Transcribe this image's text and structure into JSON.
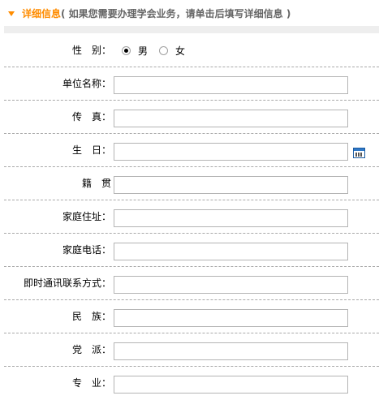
{
  "header": {
    "title": "详细信息",
    "subtitle": "( 如果您需要办理学会业务，请单击后填写详细信息 )"
  },
  "colors": {
    "accent": "#ff8c00",
    "subtitle": "#666666",
    "strip": "#eeeeee",
    "divider": "#a9a9a9"
  },
  "form": {
    "gender": {
      "label": "性　别：",
      "options": [
        "男",
        "女"
      ],
      "selected": "男"
    },
    "fields": [
      {
        "label": "单位名称：",
        "value": ""
      },
      {
        "label": "传　真：",
        "value": ""
      },
      {
        "label": "生　日：",
        "value": "",
        "icon": "calendar-icon"
      },
      {
        "label": "籍　贯",
        "value": ""
      },
      {
        "label": "家庭住址：",
        "value": ""
      },
      {
        "label": "家庭电话：",
        "value": ""
      },
      {
        "label": "即时通讯联系方式：",
        "value": ""
      },
      {
        "label": "民　族：",
        "value": ""
      },
      {
        "label": "党　派：",
        "value": ""
      },
      {
        "label": "专　业：",
        "value": ""
      }
    ]
  }
}
